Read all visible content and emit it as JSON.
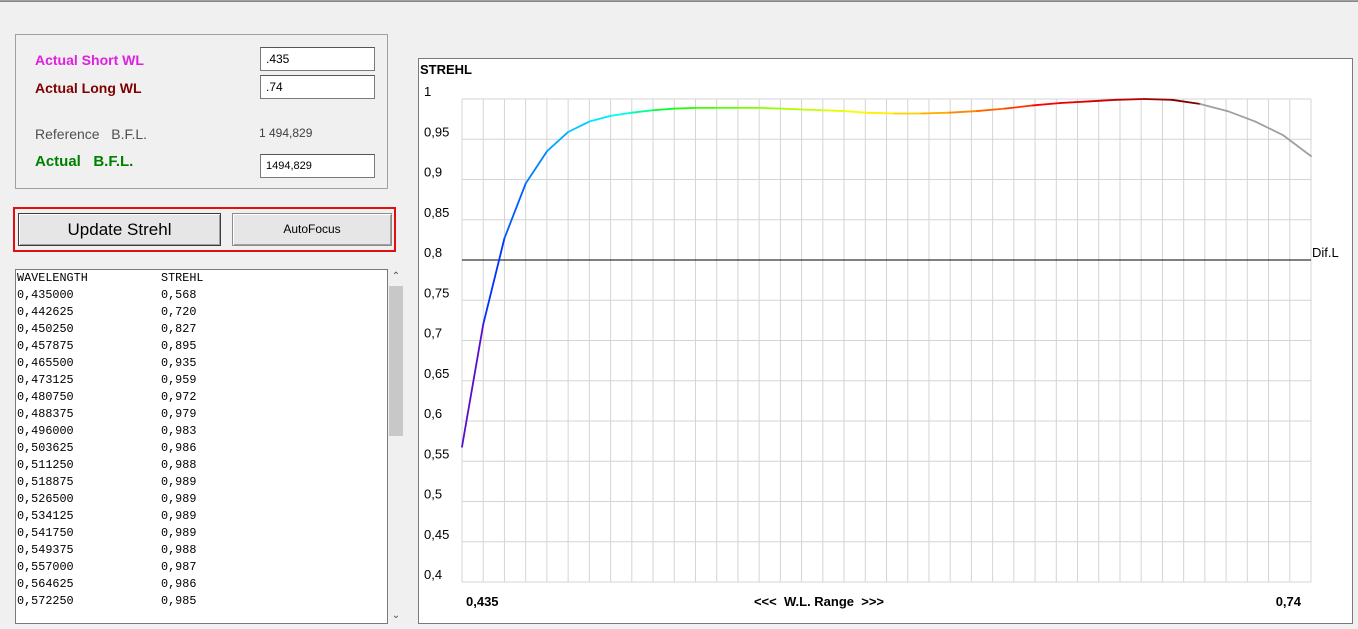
{
  "params": {
    "short_wl_label": "Actual Short WL",
    "short_wl_value": ".435",
    "long_wl_label": "Actual Long WL",
    "long_wl_value": ".74",
    "ref_bfl_label": "Reference   B.F.L.",
    "ref_bfl_value": "1 494,829",
    "actual_bfl_label": "Actual   B.F.L.",
    "actual_bfl_value": "1494,829"
  },
  "buttons": {
    "update_label": "Update Strehl",
    "autofocus_label": "AutoFocus"
  },
  "list": {
    "header": [
      "WAVELENGTH",
      "STREHL"
    ],
    "rows": [
      [
        "0,435000",
        "0,568"
      ],
      [
        "0,442625",
        "0,720"
      ],
      [
        "0,450250",
        "0,827"
      ],
      [
        "0,457875",
        "0,895"
      ],
      [
        "0,465500",
        "0,935"
      ],
      [
        "0,473125",
        "0,959"
      ],
      [
        "0,480750",
        "0,972"
      ],
      [
        "0,488375",
        "0,979"
      ],
      [
        "0,496000",
        "0,983"
      ],
      [
        "0,503625",
        "0,986"
      ],
      [
        "0,511250",
        "0,988"
      ],
      [
        "0,518875",
        "0,989"
      ],
      [
        "0,526500",
        "0,989"
      ],
      [
        "0,534125",
        "0,989"
      ],
      [
        "0,541750",
        "0,989"
      ],
      [
        "0,549375",
        "0,988"
      ],
      [
        "0,557000",
        "0,987"
      ],
      [
        "0,564625",
        "0,986"
      ],
      [
        "0,572250",
        "0,985"
      ]
    ]
  },
  "colors": {
    "short_label": "#e020e0",
    "long_label": "#800000",
    "actual_label": "#008000",
    "highlight_border": "#e01010"
  },
  "chart_data": {
    "type": "line",
    "title": "STREHL",
    "xlabel": "<<<  W.L. Range  >>>",
    "x_min_label": "0,435",
    "x_max_label": "0,74",
    "xlim": [
      0.435,
      0.74
    ],
    "ylim": [
      0.4,
      1.0
    ],
    "yticks": [
      1,
      0.95,
      0.9,
      0.85,
      0.8,
      0.75,
      0.7,
      0.65,
      0.6,
      0.55,
      0.5,
      0.45,
      0.4
    ],
    "ytick_labels": [
      "1",
      "0,95",
      "0,9",
      "0,85",
      "0,8",
      "0,75",
      "0,7",
      "0,65",
      "0,6",
      "0,55",
      "0,5",
      "0,45",
      "0,4"
    ],
    "grid": true,
    "reference_line": {
      "value": 0.8,
      "label": "Dif.L"
    },
    "series": [
      {
        "x": [
          0.435,
          0.442625,
          0.45025,
          0.457875,
          0.4655,
          0.473125,
          0.48075,
          0.488375,
          0.496,
          0.503625,
          0.51125,
          0.518875,
          0.5265,
          0.534125,
          0.54175,
          0.549375,
          0.557,
          0.564625,
          0.57225,
          0.58,
          0.59,
          0.6,
          0.61,
          0.62,
          0.63,
          0.64,
          0.65,
          0.66,
          0.67,
          0.68,
          0.69,
          0.7,
          0.71,
          0.72,
          0.73,
          0.74
        ],
        "values": [
          0.568,
          0.72,
          0.827,
          0.895,
          0.935,
          0.959,
          0.972,
          0.979,
          0.983,
          0.986,
          0.988,
          0.989,
          0.989,
          0.989,
          0.989,
          0.988,
          0.987,
          0.986,
          0.985,
          0.983,
          0.982,
          0.982,
          0.983,
          0.985,
          0.988,
          0.992,
          0.995,
          0.997,
          0.999,
          1.0,
          0.999,
          0.994,
          0.985,
          0.972,
          0.955,
          0.929
        ]
      }
    ]
  }
}
